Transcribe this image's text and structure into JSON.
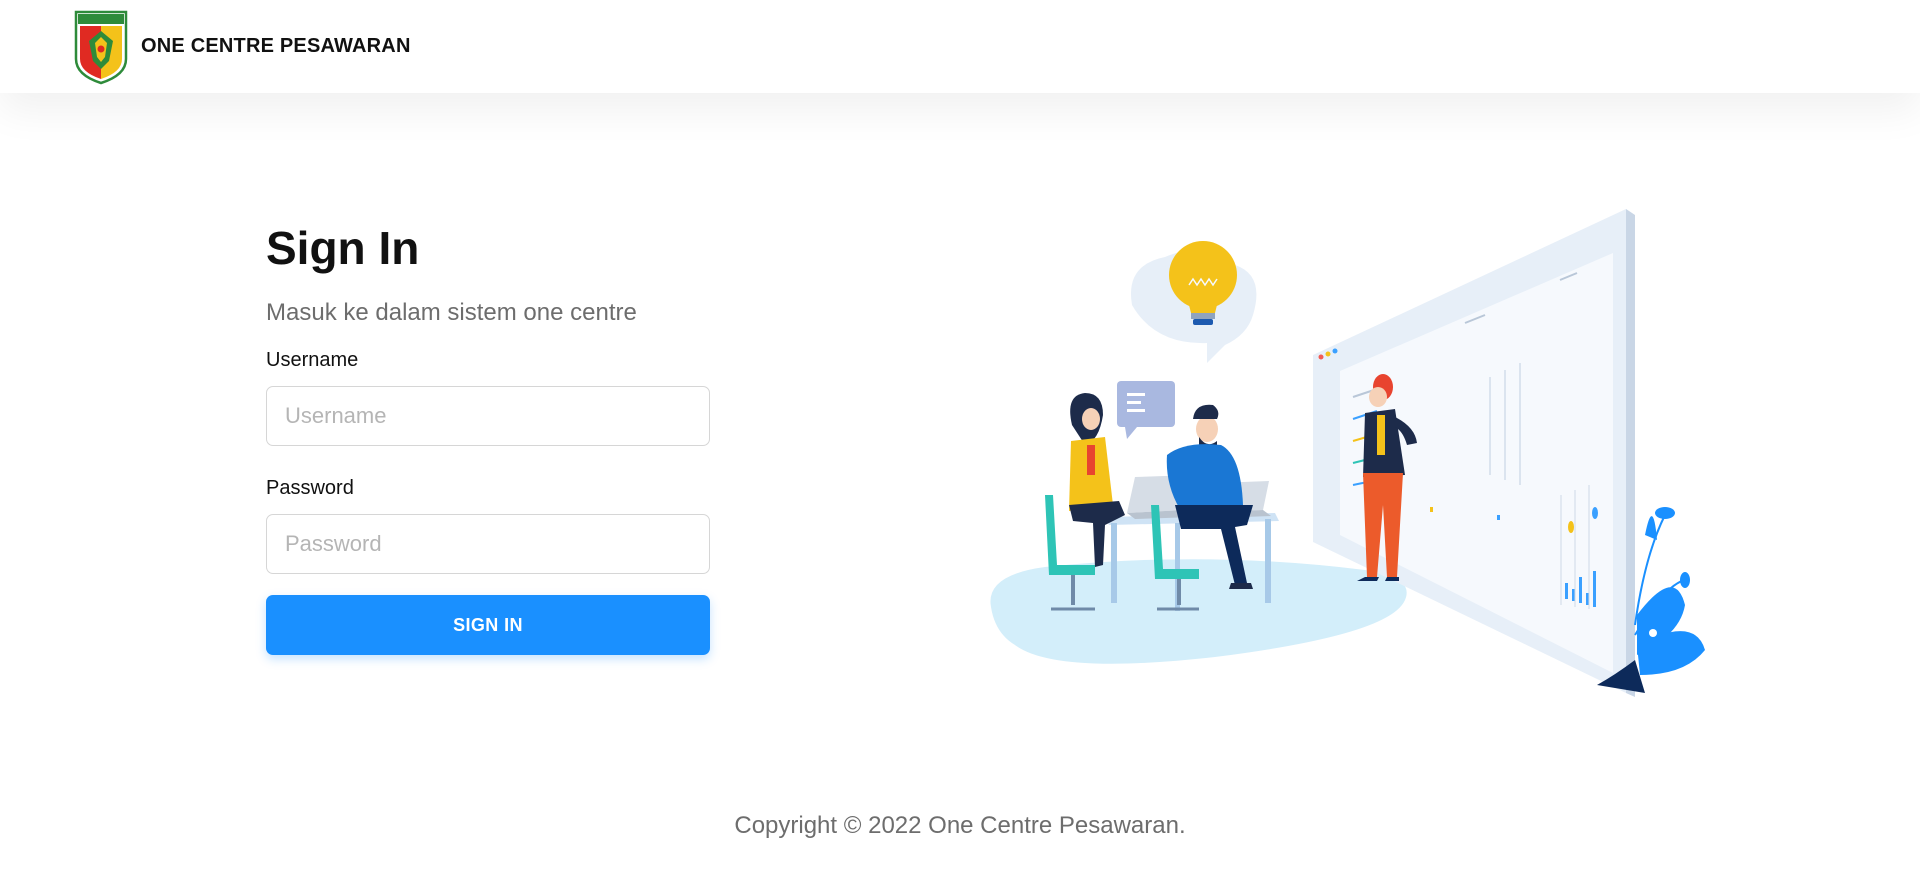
{
  "header": {
    "logo_text": "PESAWARAN",
    "app_name": "ONE CENTRE PESAWARAN"
  },
  "login": {
    "title": "Sign In",
    "subtitle": "Masuk ke dalam sistem one centre",
    "username_label": "Username",
    "username_placeholder": "Username",
    "username_value": "",
    "password_label": "Password",
    "password_placeholder": "Password",
    "password_value": "",
    "submit_label": "SIGN IN"
  },
  "footer": {
    "copyright": "Copyright © 2022 One Centre Pesawaran."
  },
  "colors": {
    "primary": "#1a90ff",
    "text": "#111111",
    "muted": "#6d6d6d"
  }
}
